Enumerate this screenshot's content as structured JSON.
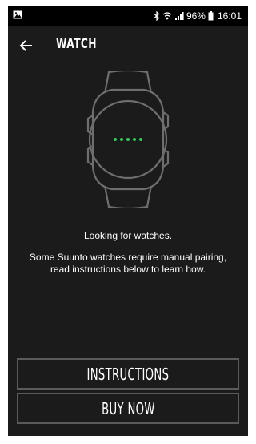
{
  "statusbar": {
    "battery_percent": "96%",
    "time": "16:01",
    "icons": [
      "image-icon",
      "bluetooth-icon",
      "wifi-icon",
      "signal-icon",
      "battery-icon"
    ]
  },
  "header": {
    "title": "WATCH",
    "back_icon": "arrow-left-icon"
  },
  "main": {
    "status": "Looking for watches.",
    "info": "Some Suunto watches require manual pairing, read instructions below to learn how.",
    "illustration": "watch-icon",
    "search_dots": 5
  },
  "buttons": {
    "instructions": "INSTRUCTIONS",
    "buy_now": "BUY NOW"
  },
  "colors": {
    "background": "#1b1b1b",
    "accent_green": "#2ecc55",
    "button_border": "#5a5a5a",
    "watch_outline": "#6e6e6e"
  }
}
